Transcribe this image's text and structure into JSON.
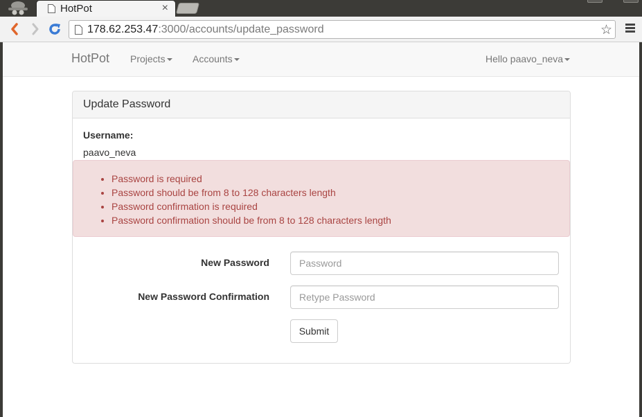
{
  "browser": {
    "tab_title": "HotPot",
    "tab_close": "×",
    "url_host": "178.62.253.47",
    "url_rest": ":3000/accounts/update_password",
    "star": "☆"
  },
  "navbar": {
    "brand": "HotPot",
    "projects": "Projects",
    "accounts": "Accounts",
    "user": "Hello paavo_neva"
  },
  "panel": {
    "heading": "Update Password",
    "username_label": "Username:",
    "username_value": "paavo_neva",
    "errors": [
      "Password is required",
      "Password should be from 8 to 128 characters length",
      "Password confirmation is required",
      "Password confirmation should be from 8 to 128 characters length"
    ],
    "new_password_label": "New Password",
    "new_password_placeholder": "Password",
    "confirm_label": "New Password Confirmation",
    "confirm_placeholder": "Retype Password",
    "submit": "Submit"
  },
  "colors": {
    "alert_bg": "#f2dede",
    "alert_text": "#a94442",
    "reload_blue": "#3a7bd5",
    "back_orange": "#e0662b"
  }
}
